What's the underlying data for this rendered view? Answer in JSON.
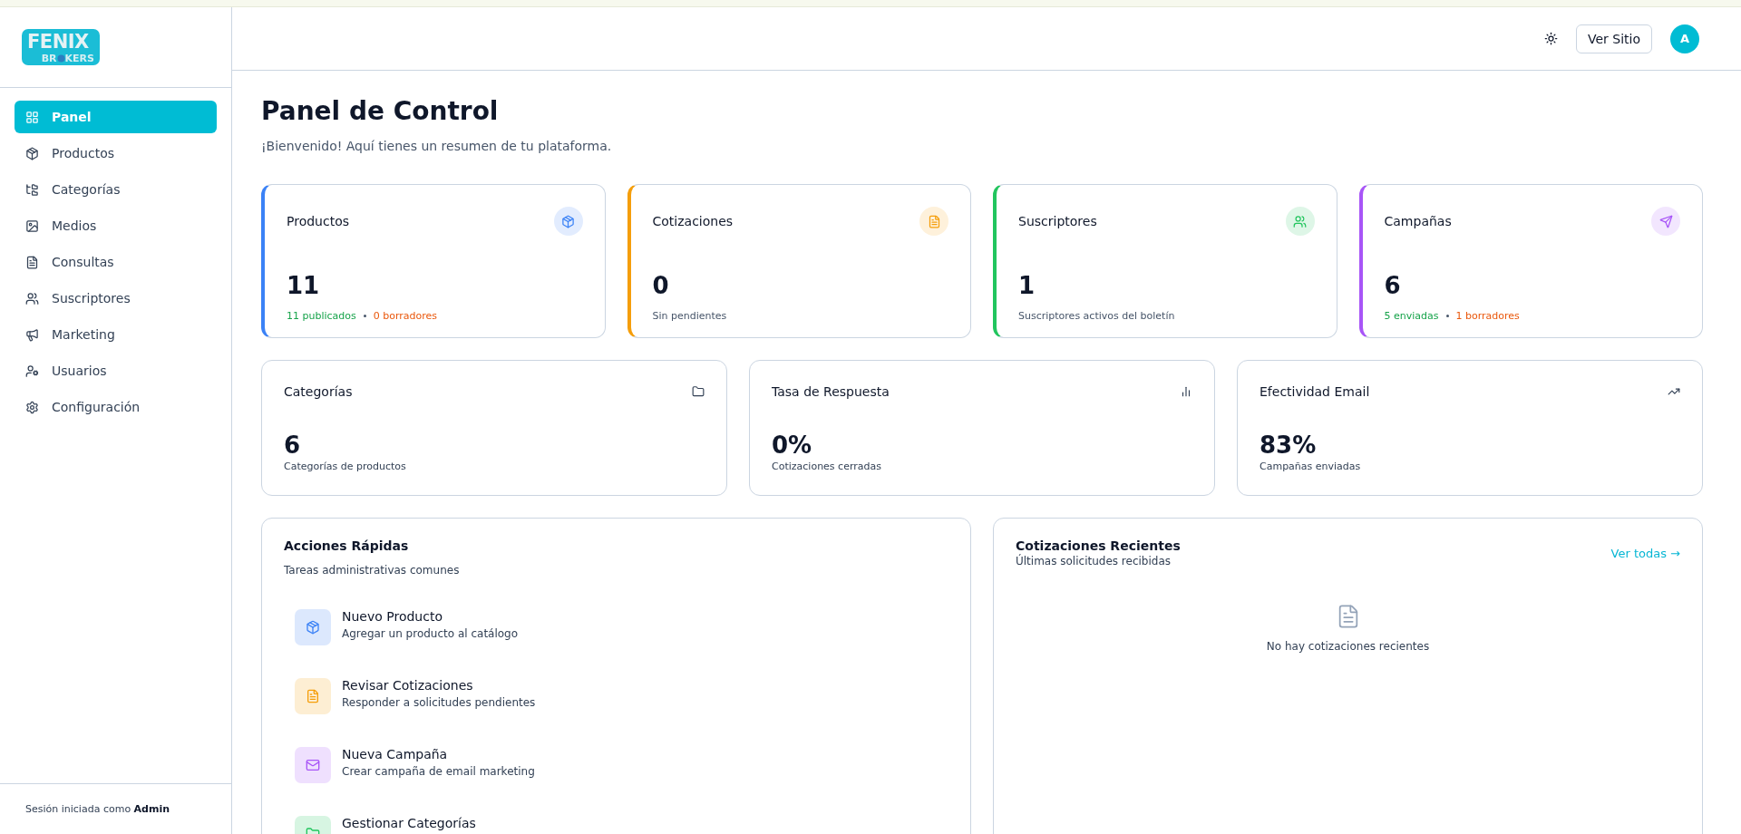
{
  "brand": {
    "line_1": "FENIX",
    "line_2_start": "BR",
    "line_2_end": "KERS"
  },
  "sidebar": {
    "items": [
      {
        "label": "Panel",
        "selected": true
      },
      {
        "label": "Productos",
        "selected": false
      },
      {
        "label": "Categorías",
        "selected": false
      },
      {
        "label": "Medios",
        "selected": false
      },
      {
        "label": "Consultas",
        "selected": false
      },
      {
        "label": "Suscriptores",
        "selected": false
      },
      {
        "label": "Marketing",
        "selected": false
      },
      {
        "label": "Usuarios",
        "selected": false
      },
      {
        "label": "Configuración",
        "selected": false
      }
    ],
    "footer": {
      "text": "Sesión iniciada como",
      "user": "Admin"
    }
  },
  "header": {
    "button": "Ver Sitio",
    "avatar": "A"
  },
  "page": {
    "title": "Panel de Control",
    "subtitle": "¡Bienvenido! Aquí tienes un resumen de tu plataforma."
  },
  "stats": [
    {
      "title": "Productos",
      "value": "11",
      "color": "#3b82f6",
      "details": [
        {
          "text": "11 publicados",
          "color": "#16a34a"
        },
        {
          "text": "0 borradores",
          "color": "#ea580c"
        }
      ]
    },
    {
      "title": "Cotizaciones",
      "value": "0",
      "color": "#f59e0b",
      "details": [
        {
          "text": "Sin pendientes",
          "color": "#475569"
        }
      ]
    },
    {
      "title": "Suscriptores",
      "value": "1",
      "color": "#22c55e",
      "details": [
        {
          "text": "Suscriptores activos del boletín",
          "color": "#475569"
        }
      ]
    },
    {
      "title": "Campañas",
      "value": "6",
      "color": "#a855f7",
      "details": [
        {
          "text": "5 enviadas",
          "color": "#16a34a"
        },
        {
          "text": "1 borradores",
          "color": "#ea580c"
        }
      ]
    }
  ],
  "metrics": [
    {
      "title": "Categorías",
      "value": "6",
      "caption": "Categorías de productos"
    },
    {
      "title": "Tasa de Respuesta",
      "value": "0%",
      "caption": "Cotizaciones cerradas"
    },
    {
      "title": "Efectividad Email",
      "value": "83%",
      "caption": "Campañas enviadas"
    }
  ],
  "quick_actions": {
    "title": "Acciones Rápidas",
    "subtitle": "Tareas administrativas comunes",
    "items": [
      {
        "title": "Nuevo Producto",
        "description": "Agregar un producto al catálogo",
        "color": "#3b82f6"
      },
      {
        "title": "Revisar Cotizaciones",
        "description": "Responder a solicitudes pendientes",
        "color": "#f59e0b"
      },
      {
        "title": "Nueva Campaña",
        "description": "Crear campaña de email marketing",
        "color": "#a855f7"
      },
      {
        "title": "Gestionar Categorías",
        "color": "#22c55e"
      }
    ]
  },
  "recent_quotes": {
    "title": "Cotizaciones Recientes",
    "subtitle": "Últimas solicitudes recibidas",
    "link": "Ver todas →",
    "empty": "No hay cotizaciones recientes"
  }
}
